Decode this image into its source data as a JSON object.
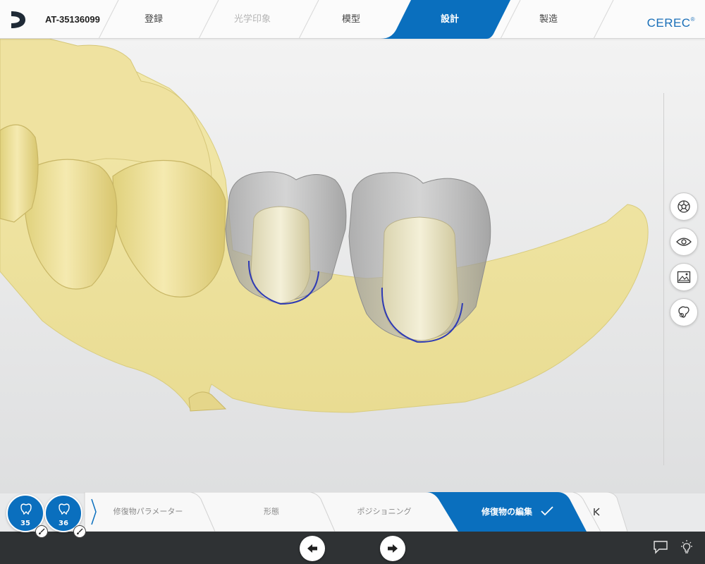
{
  "header": {
    "case_id": "AT-35136099",
    "brand": "CEREC",
    "brand_mark": "®",
    "steps": [
      {
        "label": "登録",
        "state": "normal"
      },
      {
        "label": "光学印象",
        "state": "disabled"
      },
      {
        "label": "模型",
        "state": "normal"
      },
      {
        "label": "設計",
        "state": "active"
      },
      {
        "label": "製造",
        "state": "normal"
      }
    ]
  },
  "toolbar_right": {
    "icons": [
      "restoration-palette-icon",
      "visibility-eye-icon",
      "image-view-icon",
      "tooth-tool-icon"
    ]
  },
  "restorations": [
    {
      "tooth": "35"
    },
    {
      "tooth": "36"
    }
  ],
  "design_phases": [
    {
      "label": "修復物パラメーター",
      "state": "normal"
    },
    {
      "label": "形態",
      "state": "normal"
    },
    {
      "label": "ポジショニング",
      "state": "normal"
    },
    {
      "label": "修復物の編集",
      "state": "active"
    }
  ],
  "colors": {
    "accent": "#0a6fbe",
    "brand_text": "#1a6fb8",
    "model": "#efe3a2",
    "footer": "#2f3234"
  }
}
